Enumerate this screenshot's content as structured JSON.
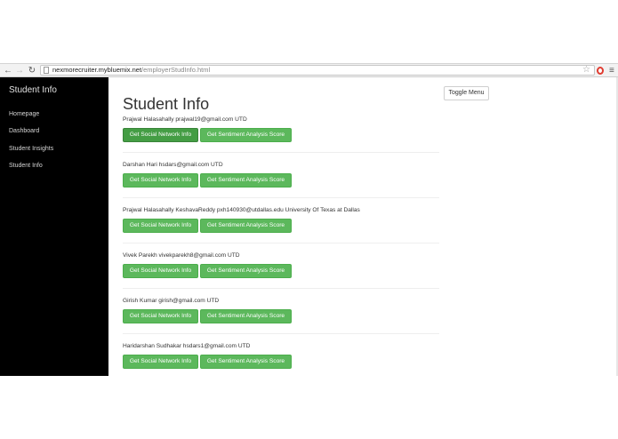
{
  "browser": {
    "url_host": "nexmorecruiter.mybluemix.net",
    "url_path": "/employerStudInfo.html"
  },
  "sidebar": {
    "brand": "Student Info",
    "items": [
      {
        "label": "Homepage"
      },
      {
        "label": "Dashboard"
      },
      {
        "label": "Student Insights"
      },
      {
        "label": "Student Info"
      }
    ]
  },
  "main": {
    "toggle_label": "Toggle Menu",
    "title": "Student Info",
    "social_label": "Get Social Network Info",
    "sentiment_label": "Get Sentiment Analysis Score",
    "students": [
      {
        "text": "Prajwal Halasahally prajwal19@gmail.com UTD"
      },
      {
        "text": "Darshan Hari hsdars@gmail.com UTD"
      },
      {
        "text": "Prajwal Halasahally KeshavaReddy pxh140930@utdallas.edu University Of Texas at Dallas"
      },
      {
        "text": "Vivek Parekh vivekparekh8@gmail.com UTD"
      },
      {
        "text": "Girish Kumar girish@gmail.com UTD"
      },
      {
        "text": "Haridarshan Sudhakar hsdars1@gmail.com UTD"
      }
    ]
  },
  "colors": {
    "sidebar_bg": "#000000",
    "button_green": "#5cb85c",
    "button_green_active": "#449d44"
  },
  "icons": [
    "back-arrow-icon",
    "forward-arrow-icon",
    "reload-icon",
    "page-icon",
    "star-icon",
    "extension-icon",
    "menu-icon"
  ]
}
